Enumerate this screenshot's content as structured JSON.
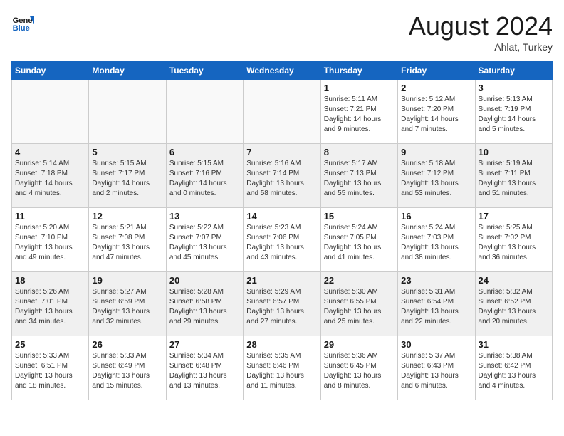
{
  "header": {
    "logo_line1": "General",
    "logo_line2": "Blue",
    "month_title": "August 2024",
    "location": "Ahlat, Turkey"
  },
  "weekdays": [
    "Sunday",
    "Monday",
    "Tuesday",
    "Wednesday",
    "Thursday",
    "Friday",
    "Saturday"
  ],
  "weeks": [
    [
      {
        "day": "",
        "info": ""
      },
      {
        "day": "",
        "info": ""
      },
      {
        "day": "",
        "info": ""
      },
      {
        "day": "",
        "info": ""
      },
      {
        "day": "1",
        "info": "Sunrise: 5:11 AM\nSunset: 7:21 PM\nDaylight: 14 hours\nand 9 minutes."
      },
      {
        "day": "2",
        "info": "Sunrise: 5:12 AM\nSunset: 7:20 PM\nDaylight: 14 hours\nand 7 minutes."
      },
      {
        "day": "3",
        "info": "Sunrise: 5:13 AM\nSunset: 7:19 PM\nDaylight: 14 hours\nand 5 minutes."
      }
    ],
    [
      {
        "day": "4",
        "info": "Sunrise: 5:14 AM\nSunset: 7:18 PM\nDaylight: 14 hours\nand 4 minutes."
      },
      {
        "day": "5",
        "info": "Sunrise: 5:15 AM\nSunset: 7:17 PM\nDaylight: 14 hours\nand 2 minutes."
      },
      {
        "day": "6",
        "info": "Sunrise: 5:15 AM\nSunset: 7:16 PM\nDaylight: 14 hours\nand 0 minutes."
      },
      {
        "day": "7",
        "info": "Sunrise: 5:16 AM\nSunset: 7:14 PM\nDaylight: 13 hours\nand 58 minutes."
      },
      {
        "day": "8",
        "info": "Sunrise: 5:17 AM\nSunset: 7:13 PM\nDaylight: 13 hours\nand 55 minutes."
      },
      {
        "day": "9",
        "info": "Sunrise: 5:18 AM\nSunset: 7:12 PM\nDaylight: 13 hours\nand 53 minutes."
      },
      {
        "day": "10",
        "info": "Sunrise: 5:19 AM\nSunset: 7:11 PM\nDaylight: 13 hours\nand 51 minutes."
      }
    ],
    [
      {
        "day": "11",
        "info": "Sunrise: 5:20 AM\nSunset: 7:10 PM\nDaylight: 13 hours\nand 49 minutes."
      },
      {
        "day": "12",
        "info": "Sunrise: 5:21 AM\nSunset: 7:08 PM\nDaylight: 13 hours\nand 47 minutes."
      },
      {
        "day": "13",
        "info": "Sunrise: 5:22 AM\nSunset: 7:07 PM\nDaylight: 13 hours\nand 45 minutes."
      },
      {
        "day": "14",
        "info": "Sunrise: 5:23 AM\nSunset: 7:06 PM\nDaylight: 13 hours\nand 43 minutes."
      },
      {
        "day": "15",
        "info": "Sunrise: 5:24 AM\nSunset: 7:05 PM\nDaylight: 13 hours\nand 41 minutes."
      },
      {
        "day": "16",
        "info": "Sunrise: 5:24 AM\nSunset: 7:03 PM\nDaylight: 13 hours\nand 38 minutes."
      },
      {
        "day": "17",
        "info": "Sunrise: 5:25 AM\nSunset: 7:02 PM\nDaylight: 13 hours\nand 36 minutes."
      }
    ],
    [
      {
        "day": "18",
        "info": "Sunrise: 5:26 AM\nSunset: 7:01 PM\nDaylight: 13 hours\nand 34 minutes."
      },
      {
        "day": "19",
        "info": "Sunrise: 5:27 AM\nSunset: 6:59 PM\nDaylight: 13 hours\nand 32 minutes."
      },
      {
        "day": "20",
        "info": "Sunrise: 5:28 AM\nSunset: 6:58 PM\nDaylight: 13 hours\nand 29 minutes."
      },
      {
        "day": "21",
        "info": "Sunrise: 5:29 AM\nSunset: 6:57 PM\nDaylight: 13 hours\nand 27 minutes."
      },
      {
        "day": "22",
        "info": "Sunrise: 5:30 AM\nSunset: 6:55 PM\nDaylight: 13 hours\nand 25 minutes."
      },
      {
        "day": "23",
        "info": "Sunrise: 5:31 AM\nSunset: 6:54 PM\nDaylight: 13 hours\nand 22 minutes."
      },
      {
        "day": "24",
        "info": "Sunrise: 5:32 AM\nSunset: 6:52 PM\nDaylight: 13 hours\nand 20 minutes."
      }
    ],
    [
      {
        "day": "25",
        "info": "Sunrise: 5:33 AM\nSunset: 6:51 PM\nDaylight: 13 hours\nand 18 minutes."
      },
      {
        "day": "26",
        "info": "Sunrise: 5:33 AM\nSunset: 6:49 PM\nDaylight: 13 hours\nand 15 minutes."
      },
      {
        "day": "27",
        "info": "Sunrise: 5:34 AM\nSunset: 6:48 PM\nDaylight: 13 hours\nand 13 minutes."
      },
      {
        "day": "28",
        "info": "Sunrise: 5:35 AM\nSunset: 6:46 PM\nDaylight: 13 hours\nand 11 minutes."
      },
      {
        "day": "29",
        "info": "Sunrise: 5:36 AM\nSunset: 6:45 PM\nDaylight: 13 hours\nand 8 minutes."
      },
      {
        "day": "30",
        "info": "Sunrise: 5:37 AM\nSunset: 6:43 PM\nDaylight: 13 hours\nand 6 minutes."
      },
      {
        "day": "31",
        "info": "Sunrise: 5:38 AM\nSunset: 6:42 PM\nDaylight: 13 hours\nand 4 minutes."
      }
    ]
  ]
}
